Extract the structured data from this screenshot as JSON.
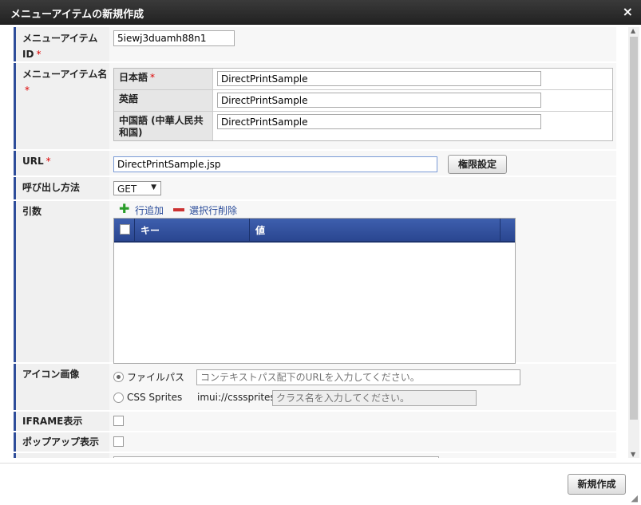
{
  "dialog": {
    "title": "メニューアイテムの新規作成",
    "close_icon": "×"
  },
  "fields": {
    "item_id_label": "メニューアイテムID",
    "item_id_value": "5iewj3duamh88n1",
    "item_name_label": "メニューアイテム名",
    "name_rows": [
      {
        "lang": "日本語",
        "required": true,
        "value": "DirectPrintSample"
      },
      {
        "lang": "英語",
        "required": false,
        "value": "DirectPrintSample"
      },
      {
        "lang": "中国語 (中華人民共和国)",
        "required": false,
        "value": "DirectPrintSample"
      }
    ],
    "url_label": "URL",
    "url_value": "DirectPrintSample.jsp",
    "permission_button": "権限設定",
    "call_method_label": "呼び出し方法",
    "call_method_value": "GET",
    "args_label": "引数",
    "add_row": "行追加",
    "delete_row": "選択行削除",
    "grid_columns": [
      "キー",
      "値"
    ],
    "icon_label": "アイコン画像",
    "icon_file_option": "ファイルパス",
    "icon_file_placeholder": "コンテキストパス配下のURLを入力してください。",
    "icon_sprite_option": "CSS Sprites",
    "icon_sprite_prefix": "imui://csssprites/",
    "icon_sprite_placeholder": "クラス名を入力してください。",
    "iframe_label": "IFRAME表示",
    "popup_label": "ポップアップ表示",
    "required_mark": "*"
  },
  "footer": {
    "create_button": "新規作成"
  },
  "colors": {
    "accent": "#2e4d9a",
    "titlebar": "#2a2a2a",
    "required": "#dd0000"
  }
}
